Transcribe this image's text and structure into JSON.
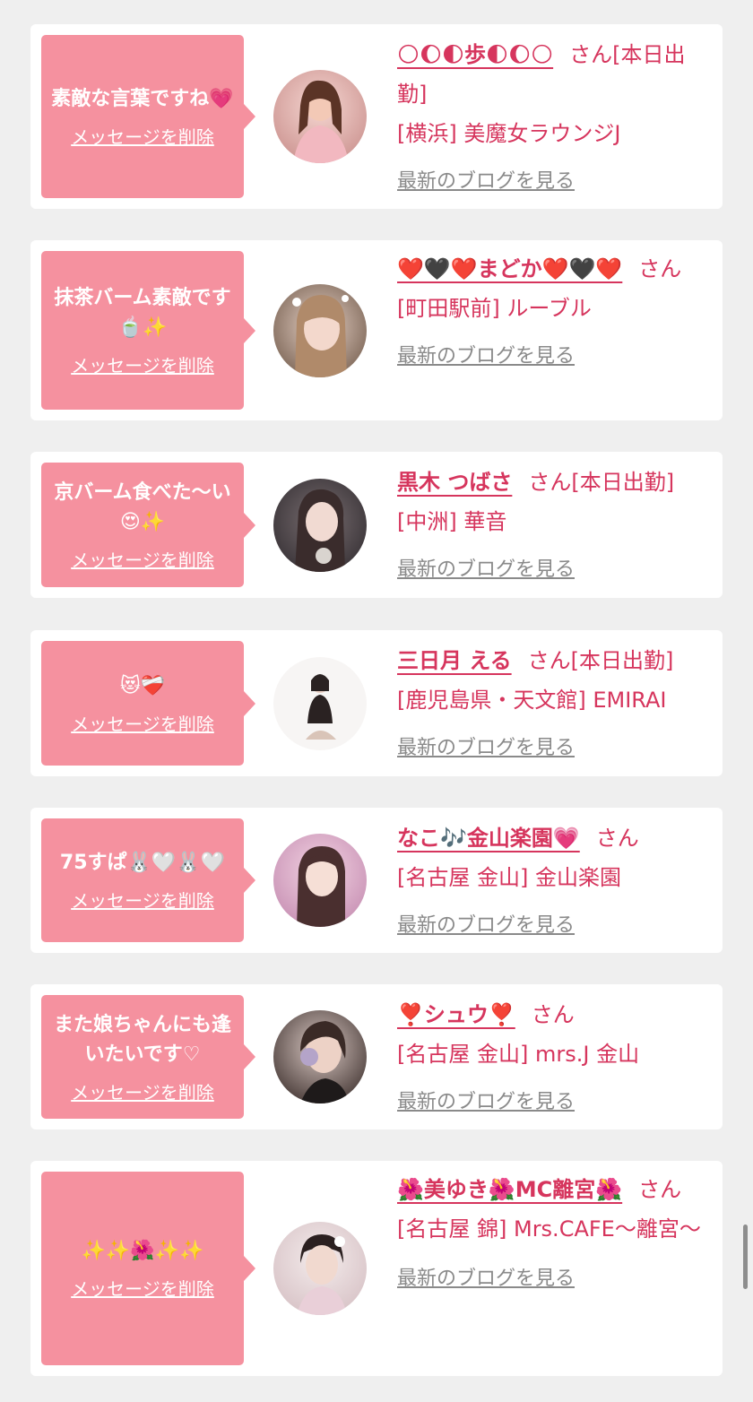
{
  "ui": {
    "delete_label": "メッセージを削除",
    "blog_label": "最新のブログを見る",
    "san_label": "さん",
    "accent_color": "#d6355d",
    "bubble_color": "#f5919f"
  },
  "cards": [
    {
      "message": "素敵な言葉ですね💗",
      "name": "🌕🌔🌓歩🌓🌔🌕",
      "status": "[本日出勤]",
      "shop": "[横浜] 美魔女ラウンジJ"
    },
    {
      "message": "抹茶バーム素敵です🍵✨",
      "name": "❤️🖤❤️まどか❤️🖤❤️",
      "status": "",
      "shop": "[町田駅前] ルーブル"
    },
    {
      "message": "京バーム食べた〜い😍✨",
      "name": "黒木 つばさ",
      "status": "[本日出勤]",
      "shop": "[中洲] 華音"
    },
    {
      "message": "😻❤️‍🩹",
      "name": "三日月 える",
      "status": "[本日出勤]",
      "shop": "[鹿児島県・天文館] EMIRAI"
    },
    {
      "message": "75すぱ🐰🤍🐰🤍",
      "name": "なこ🎶金山楽園💗",
      "status": "",
      "shop": "[名古屋 金山] 金山楽園"
    },
    {
      "message": "また娘ちゃんにも逢いたいです♡",
      "name": "❣️シュウ❣️",
      "status": "",
      "shop": "[名古屋 金山] mrs.J 金山"
    },
    {
      "message": "✨✨🌺✨✨",
      "name": "🌺美ゆき🌺MC離宮🌺",
      "status": "",
      "shop": "[名古屋 錦] Mrs.CAFE〜離宮〜"
    }
  ]
}
